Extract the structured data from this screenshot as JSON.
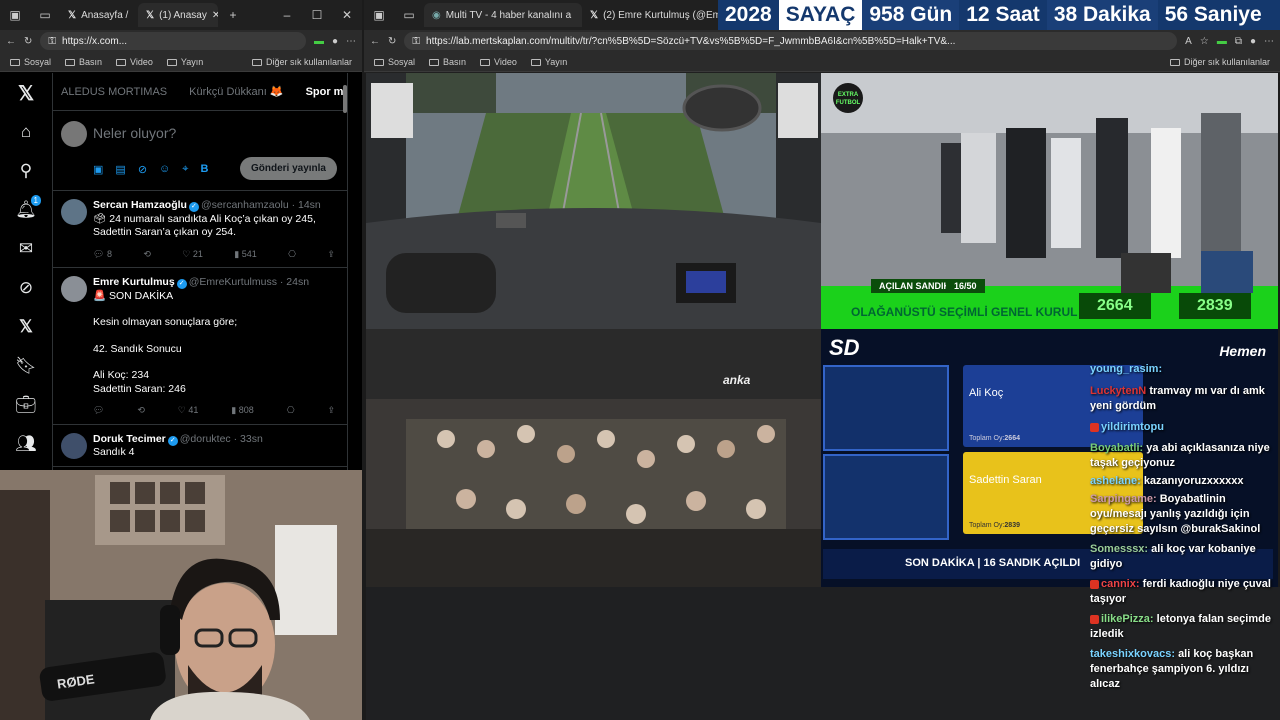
{
  "left_browser": {
    "tabs": [
      {
        "label": "Anasayfa /"
      },
      {
        "label": "(1) Anasay"
      }
    ],
    "url": "https://x.com...",
    "bookmarks": [
      "Sosyal",
      "Basın",
      "Video",
      "Yayın"
    ],
    "other_bookmarks": "Diğer sık kullanılanlar"
  },
  "x": {
    "notif_count": "1",
    "tabs": [
      "ALEDUS MORTIMAS",
      "Kürkçü Dükkanı 🦊",
      "Spor medyası"
    ],
    "compose_placeholder": "Neler oluyor?",
    "post_button": "Gönderi yayınla",
    "posts": [
      {
        "name": "Sercan Hamzaoğlu",
        "handle": "@sercanhamzaolu",
        "time": "· 14sn",
        "lines": [
          "🗳 24 numaralı sandıkta Ali Koç’a çıkan oy 245,",
          "Sadettin Saran’a çıkan oy 254."
        ],
        "replies": "8",
        "likes": "21",
        "views": "541"
      },
      {
        "name": "Emre Kurtulmuş",
        "handle": "@EmreKurtulmuss",
        "time": "· 24sn",
        "lines": [
          "🚨 SON DAKİKA",
          "",
          "Kesin olmayan sonuçlara göre;",
          "",
          "42. Sandık Sonucu",
          "",
          "Ali Koç: 234",
          "Sadettin Saran: 246"
        ],
        "replies": "",
        "likes": "41",
        "views": "808"
      },
      {
        "name": "Doruk Tecimer",
        "handle": "@doruktec",
        "time": "· 33sn",
        "lines": [
          "Sandık 4"
        ],
        "replies": "",
        "likes": "",
        "views": ""
      }
    ]
  },
  "right_browser": {
    "tabs": [
      {
        "label": "Multi TV - 4 haber kanalını a"
      },
      {
        "label": "(2) Emre Kurtulmuş (@EmreKurt"
      }
    ],
    "url": "https://lab.mertskaplan.com/multitv/tr/?cn%5B%5D=Sözcü+TV&vs%5B%5D=F_JwmmbBA6I&cn%5B%5D=Halk+TV&...",
    "bookmarks": [
      "Sosyal",
      "Basın",
      "Video",
      "Yayın"
    ],
    "other_bookmarks": "Diğer sık kullanılanlar"
  },
  "countdown": {
    "year": "2028",
    "label": "SAYAÇ",
    "days": "958 Gün",
    "hours": "12 Saat",
    "minutes": "38 Dakika",
    "seconds": "56 Saniye"
  },
  "feed_extra": {
    "logo": "EXTRA FUTBOL",
    "opened_label": "AÇILAN SANDIK",
    "opened_count": "16/50",
    "event": "OLAĞANÜSTÜ SEÇİMLİ GENEL KURUL",
    "score_left": "2664",
    "score_right": "2839"
  },
  "feed_anka": {
    "watermark": "anka"
  },
  "feed_sd": {
    "logo": "SD",
    "brand": "Hemen",
    "candidate1": "Ali Koç",
    "candidate1_votes_label": "Toplam Oy:",
    "candidate1_votes": "2664",
    "candidate2": "Sadettin Saran",
    "candidate2_votes_label": "Toplam Oy:",
    "candidate2_votes": "2839",
    "ticker": "SON DAKİKA | 16 SANDIK AÇILDI"
  },
  "chat": [
    {
      "user": "young_rasim:",
      "msg": ""
    },
    {
      "user": "LuckytenN",
      "msg": "tramvay mı var dı amk yeni gördüm"
    },
    {
      "user": "yildirimtopu",
      "msg": ""
    },
    {
      "user": "Boyabatli:",
      "msg": "ya abi açıklasanıza niye taşak geçiyonuz"
    },
    {
      "user": "ashelane:",
      "msg": "kazanıyoruzxxxxxx"
    },
    {
      "user": "Sarpingame:",
      "msg": "Boyabatlinin oyu/mesajı yanlış yazıldığı için geçersiz sayılsın @burakSakinol"
    },
    {
      "user": "Somesssx:",
      "msg": "ali koç var kobaniye gidiyo"
    },
    {
      "user": "cannix:",
      "msg": "ferdi kadıoğlu niye çuval taşıyor"
    },
    {
      "user": "ilikePizza:",
      "msg": "letonya falan seçimde izledik"
    },
    {
      "user": "takeshixkovacs:",
      "msg": "ali koç başkan fenerbahçe şampiyon 6. yıldızı alıcaz"
    }
  ],
  "cam": {
    "mic_brand": "RØDE"
  }
}
